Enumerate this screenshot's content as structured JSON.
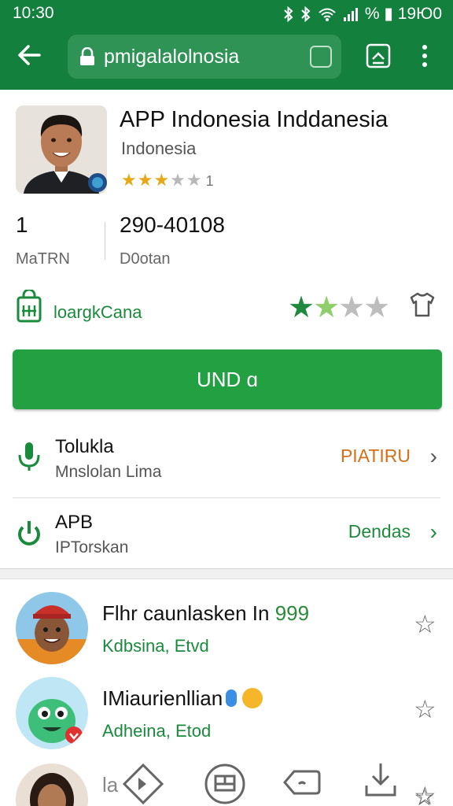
{
  "status_bar": {
    "time": "10:30",
    "right_text": "% ▮ 19Ю0"
  },
  "browser": {
    "url": "pmigalalolnosia"
  },
  "app": {
    "title": "APP Indonesia Inddanesia",
    "developer": "Indonesia",
    "rating_small": {
      "stars_full": "★★★",
      "stars_empty": "★★",
      "count": "1"
    },
    "stat1": {
      "value": "1",
      "label": "MaTRN"
    },
    "stat2": {
      "value": "290-40108",
      "label": "D0otan"
    },
    "category": "loargkCana",
    "rating_big": {
      "full": "★",
      "half": "★",
      "empty": "★★"
    },
    "install_label": "UND ɑ"
  },
  "rows": [
    {
      "title": "Tolukla",
      "subtitle": "Mnslolan Lima",
      "action": "PIATIRU",
      "action_color": "#d4701a"
    },
    {
      "title": "APB",
      "subtitle": "IPTorskan",
      "action": "Dendas",
      "action_color": "#1f8a3d"
    }
  ],
  "list": [
    {
      "title": "Flhr caunlasken In",
      "num": "999",
      "subtitle": "Kdbsina, Etvd"
    },
    {
      "title": "IMiaurienllian",
      "num": "",
      "subtitle": "Adheina, Etod"
    },
    {
      "title": "la",
      "num": "",
      "subtitle": ""
    }
  ],
  "colors": {
    "brand_green": "#13803d",
    "install_green": "#23a042",
    "accent_orange": "#d4701a"
  },
  "icons": [
    "back-arrow-icon",
    "lock-icon",
    "tab-icon",
    "share-icon",
    "more-icon",
    "shopping-bag-icon",
    "shirt-icon",
    "microphone-icon",
    "power-icon",
    "star-outline-icon",
    "home-icon",
    "apps-icon",
    "back-nav-icon",
    "download-icon"
  ]
}
